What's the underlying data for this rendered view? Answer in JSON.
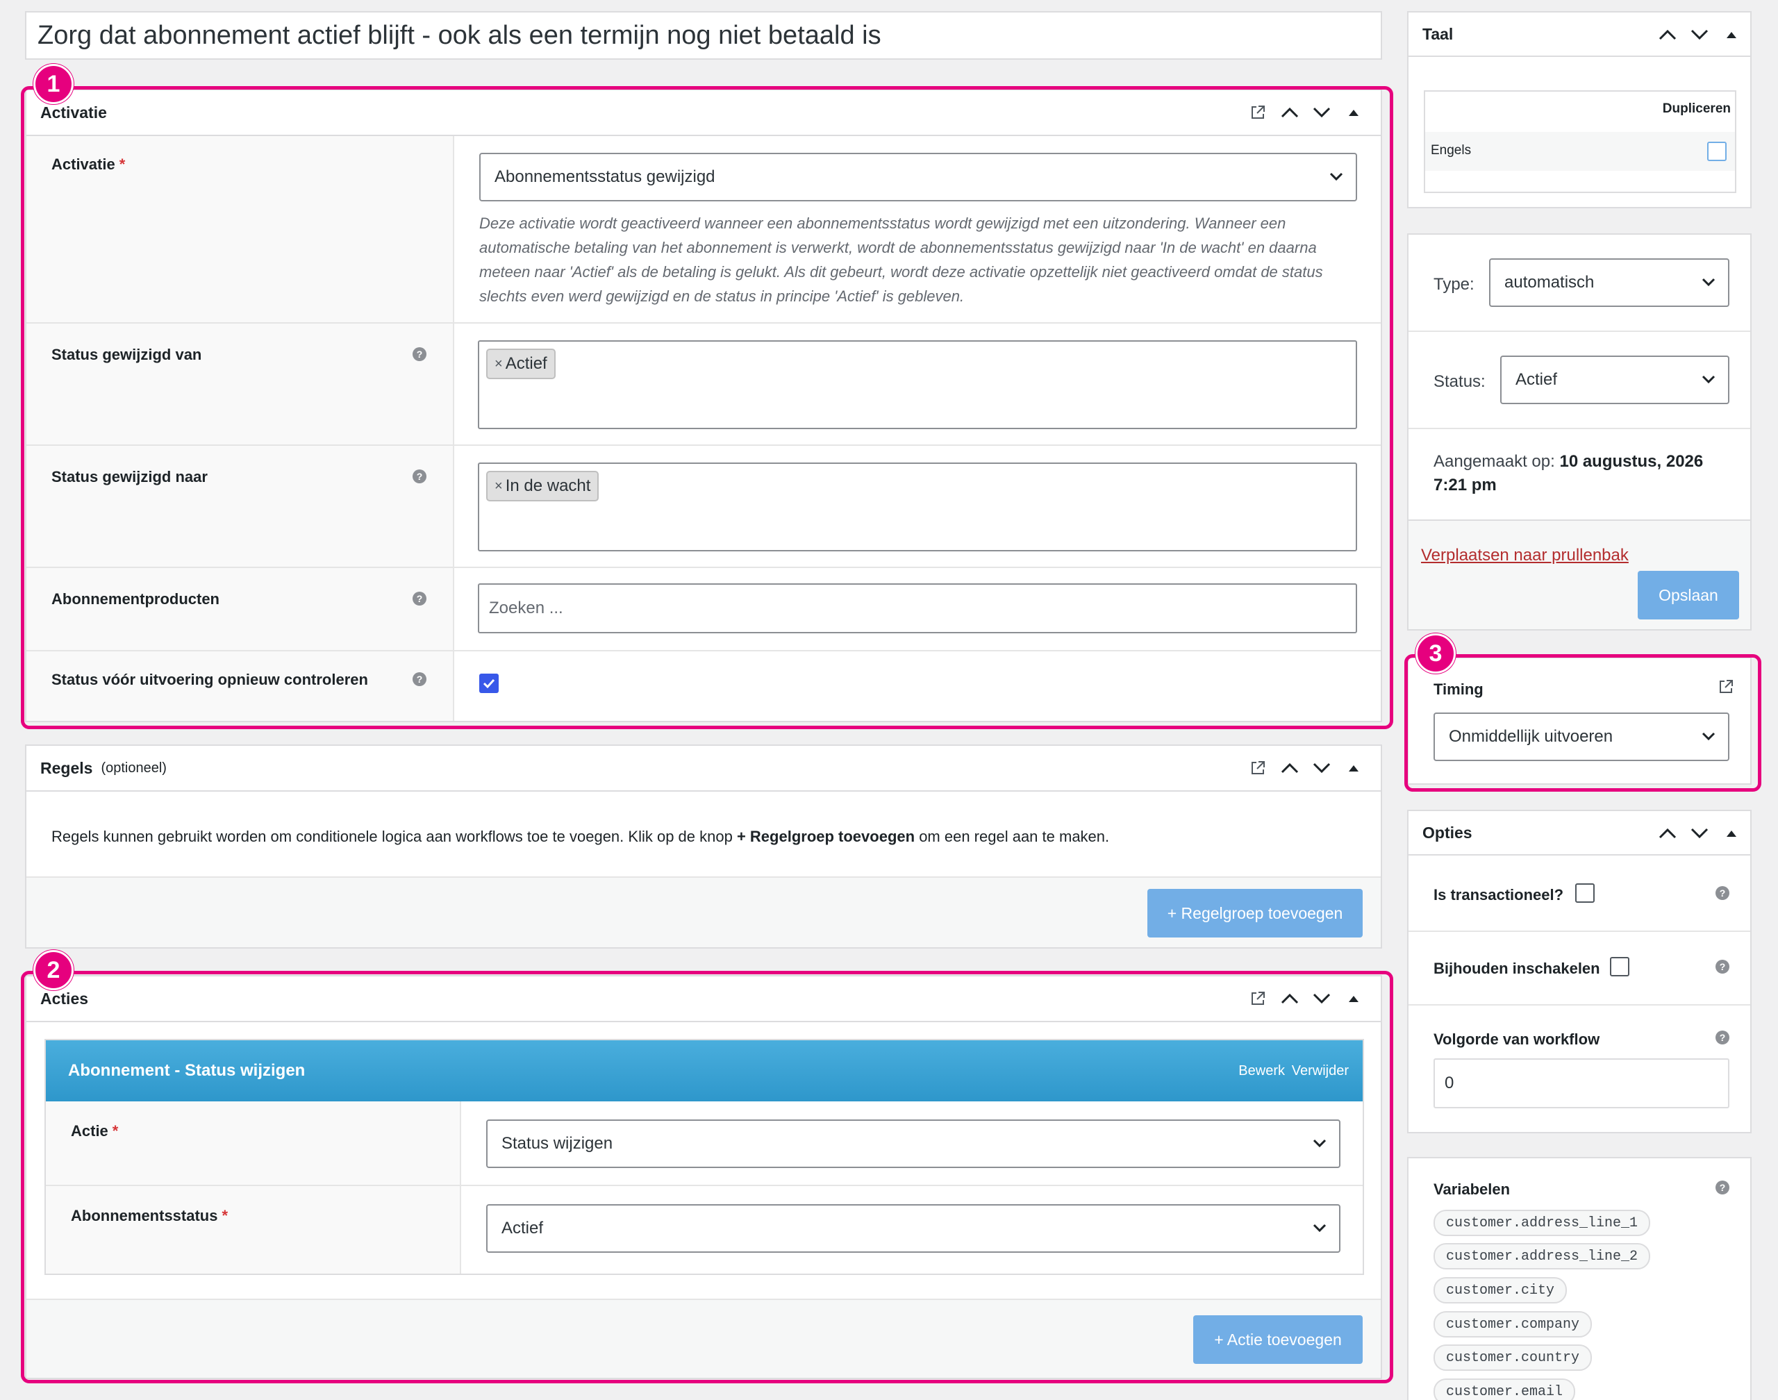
{
  "title": "Zorg dat abonnement actief blijft - ook als een termijn nog niet betaald is",
  "trigger": {
    "heading": "Activatie",
    "badge": "1",
    "label": "Activatie",
    "required": "*",
    "selected": "Abonnementsstatus gewijzigd",
    "description": "Deze activatie wordt geactiveerd wanneer een abonnementsstatus wordt gewijzigd met een uitzondering. Wanneer een automatische betaling van het abonnement is verwerkt, wordt de abonnementsstatus gewijzigd naar 'In de wacht' en daarna meteen naar 'Actief' als de betaling is gelukt. Als dit gebeurt, wordt deze activatie opzettelijk niet geactiveerd omdat de status slechts even werd gewijzigd en de status in principe 'Actief' is gebleven.",
    "from_label": "Status gewijzigd van",
    "from_chip": "Actief",
    "to_label": "Status gewijzigd naar",
    "to_chip": "In de wacht",
    "products_label": "Abonnementproducten",
    "products_placeholder": "Zoeken ...",
    "recheck_label": "Status vóór uitvoering opnieuw controleren",
    "recheck_checked": true,
    "chip_x": "×",
    "help": "?"
  },
  "rules": {
    "heading": "Regels",
    "optional": "(optioneel)",
    "text_before": "Regels kunnen gebruikt worden om conditionele logica aan workflows toe te voegen. Klik op de knop ",
    "text_bold": "+ Regelgroep toevoegen",
    "text_after": " om een regel aan te maken.",
    "add_button": "+ Regelgroep toevoegen"
  },
  "actions": {
    "heading": "Acties",
    "badge": "2",
    "item_title": "Abonnement - Status wijzigen",
    "edit": "Bewerk",
    "delete": "Verwijder",
    "action_label": "Actie",
    "action_value": "Status wijzigen",
    "status_label": "Abonnementsstatus",
    "status_value": "Actief",
    "required": "*",
    "add_button": "+ Actie toevoegen"
  },
  "language": {
    "heading": "Taal",
    "duplicate_col": "Dupliceren",
    "english": "Engels"
  },
  "publish": {
    "type_label": "Type:",
    "type_value": "automatisch",
    "status_label": "Status:",
    "status_value": "Actief",
    "created_label": "Aangemaakt op:",
    "created_date": "10 augustus, 2026",
    "created_time": "7:21 pm",
    "trash": "Verplaatsen naar prullenbak",
    "save": "Opslaan"
  },
  "timing": {
    "heading": "Timing",
    "badge": "3",
    "value": "Onmiddellijk uitvoeren"
  },
  "options": {
    "heading": "Opties",
    "transactional": "Is transactioneel?",
    "tracking": "Bijhouden inschakelen",
    "order_label": "Volgorde van workflow",
    "order_value": "0"
  },
  "variables": {
    "heading": "Variabelen",
    "items": [
      "customer.address_line_1",
      "customer.address_line_2",
      "customer.city",
      "customer.company",
      "customer.country",
      "customer.email"
    ]
  },
  "colors": {
    "accent_pink": "#e6007e",
    "action_bar": "#3aa3d4",
    "button": "#72aee6",
    "trash_link": "#b32d2e"
  }
}
